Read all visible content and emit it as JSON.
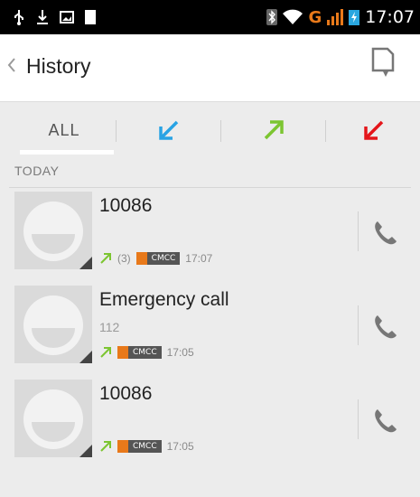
{
  "status_bar": {
    "icons_left": [
      "usb-icon",
      "download-icon",
      "image-icon",
      "battery-full-icon"
    ],
    "icons_right": [
      "bluetooth-icon",
      "wifi-icon",
      "signal-icon",
      "battery-icon"
    ],
    "network": "G",
    "time": "17:07"
  },
  "action_bar": {
    "title": "History",
    "back_icon": "chevron-left-icon",
    "filter_icon": "document-filter-icon"
  },
  "tabs": {
    "all_label": "ALL",
    "items": [
      {
        "name": "incoming",
        "icon": "incoming-arrow-icon",
        "color": "#29a3e4"
      },
      {
        "name": "outgoing",
        "icon": "outgoing-arrow-icon",
        "color": "#7cc531"
      },
      {
        "name": "missed",
        "icon": "missed-arrow-icon",
        "color": "#e4161b"
      }
    ]
  },
  "section": {
    "title": "TODAY"
  },
  "calls": [
    {
      "name": "10086",
      "number": "",
      "count": "(3)",
      "sim": "CMCC",
      "time": "17:07",
      "type": "outgoing"
    },
    {
      "name": "Emergency call",
      "number": "112",
      "count": "",
      "sim": "CMCC",
      "time": "17:05",
      "type": "outgoing"
    },
    {
      "name": "10086",
      "number": "",
      "count": "",
      "sim": "CMCC",
      "time": "17:05",
      "type": "outgoing"
    }
  ],
  "colors": {
    "outgoing": "#7cc531",
    "incoming": "#29a3e4",
    "missed": "#e4161b",
    "sim_flag": "#e8791a"
  }
}
